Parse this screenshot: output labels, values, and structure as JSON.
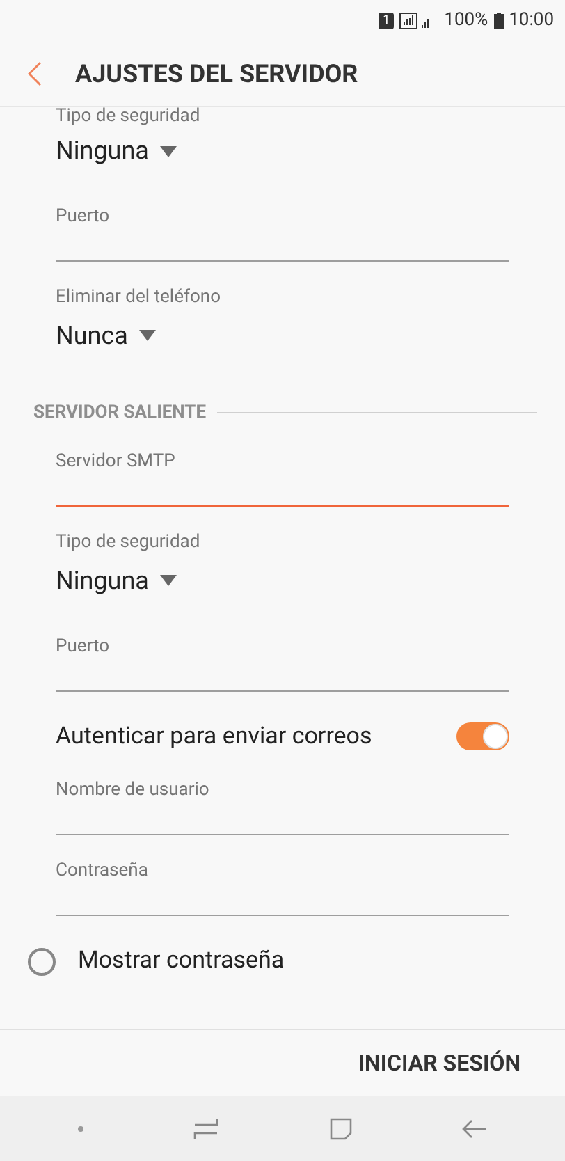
{
  "status_bar": {
    "sim": "1",
    "battery": "100%",
    "time": "10:00"
  },
  "header": {
    "title": "AJUSTES DEL SERVIDOR"
  },
  "items": [
    {
      "kind": "dropdown",
      "label": "Tipo de seguridad",
      "value": "Ninguna"
    },
    {
      "kind": "text",
      "label": "Puerto",
      "focused": false
    },
    {
      "kind": "dropdown",
      "label": "Eliminar del teléfono",
      "value": "Nunca"
    },
    {
      "kind": "section",
      "label": "SERVIDOR SALIENTE"
    },
    {
      "kind": "text",
      "label": "Servidor SMTP",
      "focused": true
    },
    {
      "kind": "dropdown",
      "label": "Tipo de seguridad",
      "value": "Ninguna"
    },
    {
      "kind": "text",
      "label": "Puerto",
      "focused": false
    },
    {
      "kind": "toggle",
      "label": "Autenticar para enviar correos",
      "on": true
    },
    {
      "kind": "text",
      "label": "Nombre de usuario",
      "focused": false
    },
    {
      "kind": "text",
      "label": "Contraseña",
      "focused": false
    },
    {
      "kind": "radio",
      "label": "Mostrar contraseña",
      "checked": false
    }
  ],
  "action": "INICIAR SESIÓN"
}
